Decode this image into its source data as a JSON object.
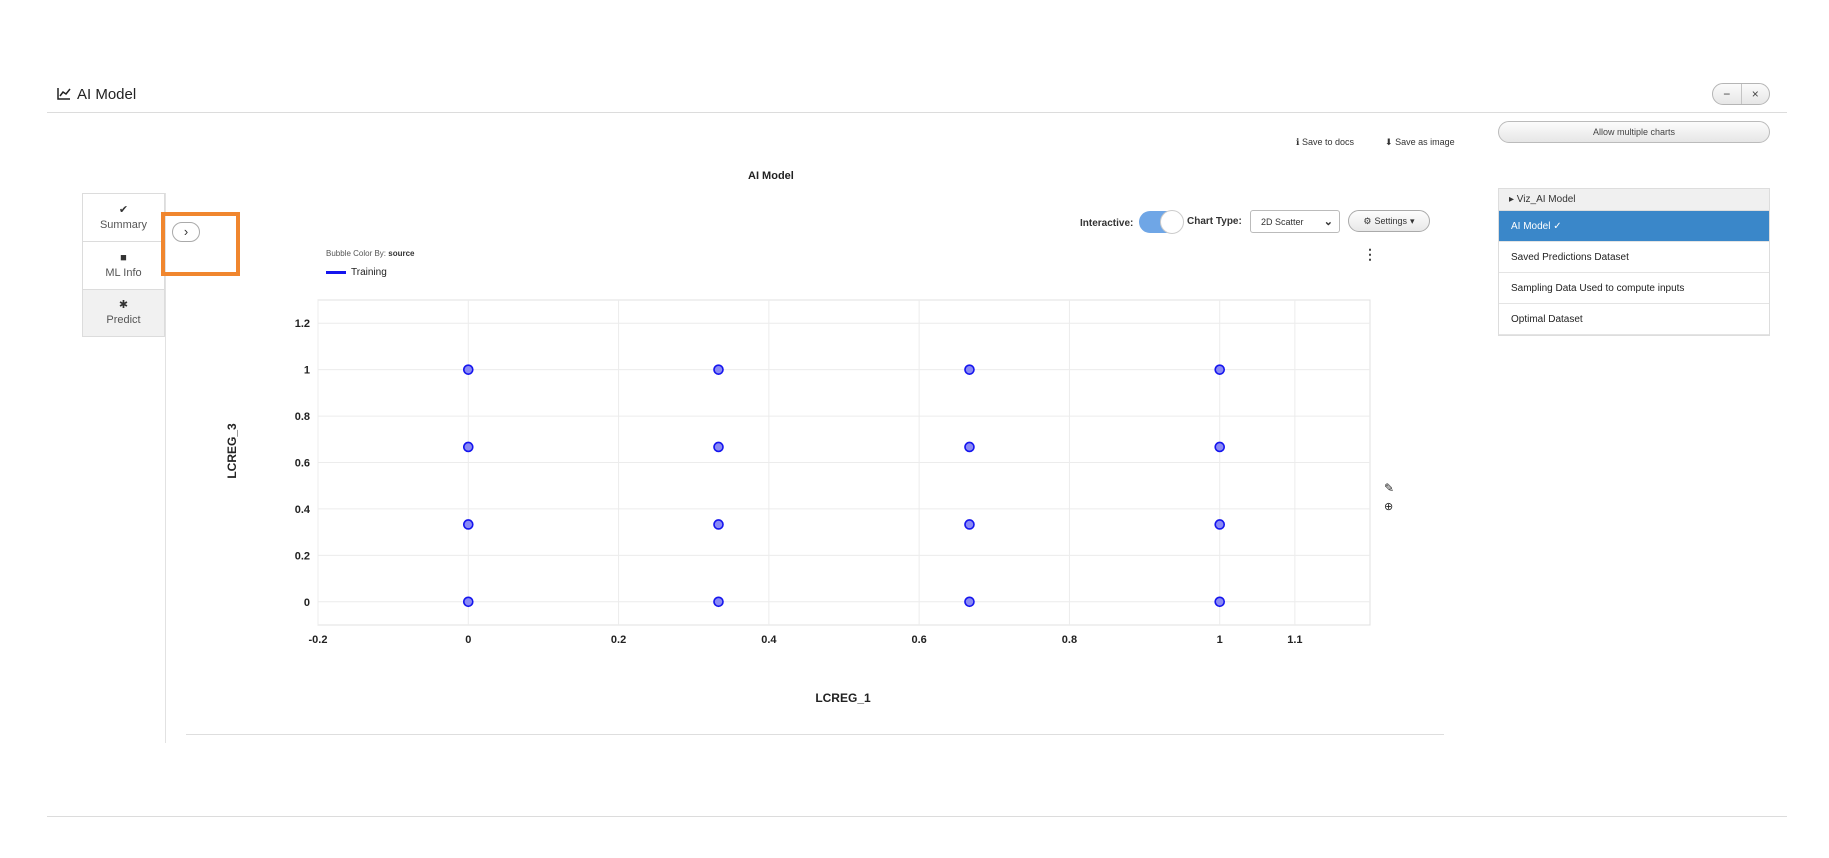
{
  "window": {
    "icon": "line-chart-icon",
    "title": "AI Model",
    "minimize": "−",
    "close": "×"
  },
  "left_tabs": [
    {
      "icon": "check-double-icon",
      "glyph": "✔",
      "label": "Summary"
    },
    {
      "icon": "document-icon",
      "glyph": "■",
      "label": "ML Info"
    },
    {
      "icon": "magic-wand-icon",
      "glyph": "✱",
      "label": "Predict"
    }
  ],
  "expand_button": {
    "icon": "chevron-right-icon",
    "glyph": "›"
  },
  "toolbar": {
    "save_docs_icon": "info-icon",
    "save_docs": "Save to docs",
    "save_image_icon": "download-icon",
    "save_image": "Save as image"
  },
  "chart_controls": {
    "interactive_label": "Interactive:",
    "interactive_on": true,
    "chart_type_label": "Chart Type:",
    "chart_type_value": "2D Scatter",
    "settings_label": "Settings",
    "settings_icon": "gear-icon"
  },
  "legend": {
    "title_prefix": "Bubble Color By:",
    "title_field": "source",
    "entry": "Training",
    "color": "#1515ee"
  },
  "chart_data": {
    "type": "scatter",
    "title": "AI Model",
    "xlabel": "LCREG_1",
    "ylabel": "LCREG_3",
    "xlim": [
      -0.2,
      1.2
    ],
    "ylim": [
      -0.1,
      1.3
    ],
    "x_ticks": [
      "-0.2",
      "0",
      "0.2",
      "0.4",
      "0.6",
      "0.8",
      "1",
      "1.1"
    ],
    "x_tick_values": [
      -0.2,
      0,
      0.2,
      0.4,
      0.6,
      0.8,
      1,
      1.1
    ],
    "y_ticks": [
      "0",
      "0.2",
      "0.4",
      "0.6",
      "0.8",
      "1",
      "1.2"
    ],
    "y_tick_values": [
      0,
      0.2,
      0.4,
      0.6,
      0.8,
      1,
      1.2
    ],
    "grid": true,
    "series": [
      {
        "name": "Training",
        "color": "#1515ee",
        "points": [
          [
            0,
            0
          ],
          [
            0,
            0.333
          ],
          [
            0,
            0.667
          ],
          [
            0,
            1
          ],
          [
            0.333,
            0
          ],
          [
            0.333,
            0.333
          ],
          [
            0.333,
            0.667
          ],
          [
            0.333,
            1
          ],
          [
            0.667,
            0
          ],
          [
            0.667,
            0.333
          ],
          [
            0.667,
            0.667
          ],
          [
            0.667,
            1
          ],
          [
            1,
            0
          ],
          [
            1,
            0.333
          ],
          [
            1,
            0.667
          ],
          [
            1,
            1
          ]
        ]
      }
    ]
  },
  "chart_tools": {
    "menu_icon": "vertical-ellipsis-icon",
    "pencil_icon": "pencil-icon",
    "zoom_icon": "zoom-in-icon"
  },
  "right_panel": {
    "allow_multiple": "Allow multiple charts",
    "group_title": "▸ Viz_AI Model",
    "items": [
      {
        "label": "AI Model ✓",
        "selected": true
      },
      {
        "label": "Saved Predictions Dataset",
        "selected": false
      },
      {
        "label": "Sampling Data Used to compute inputs",
        "selected": false
      },
      {
        "label": "Optimal Dataset",
        "selected": false
      }
    ]
  }
}
